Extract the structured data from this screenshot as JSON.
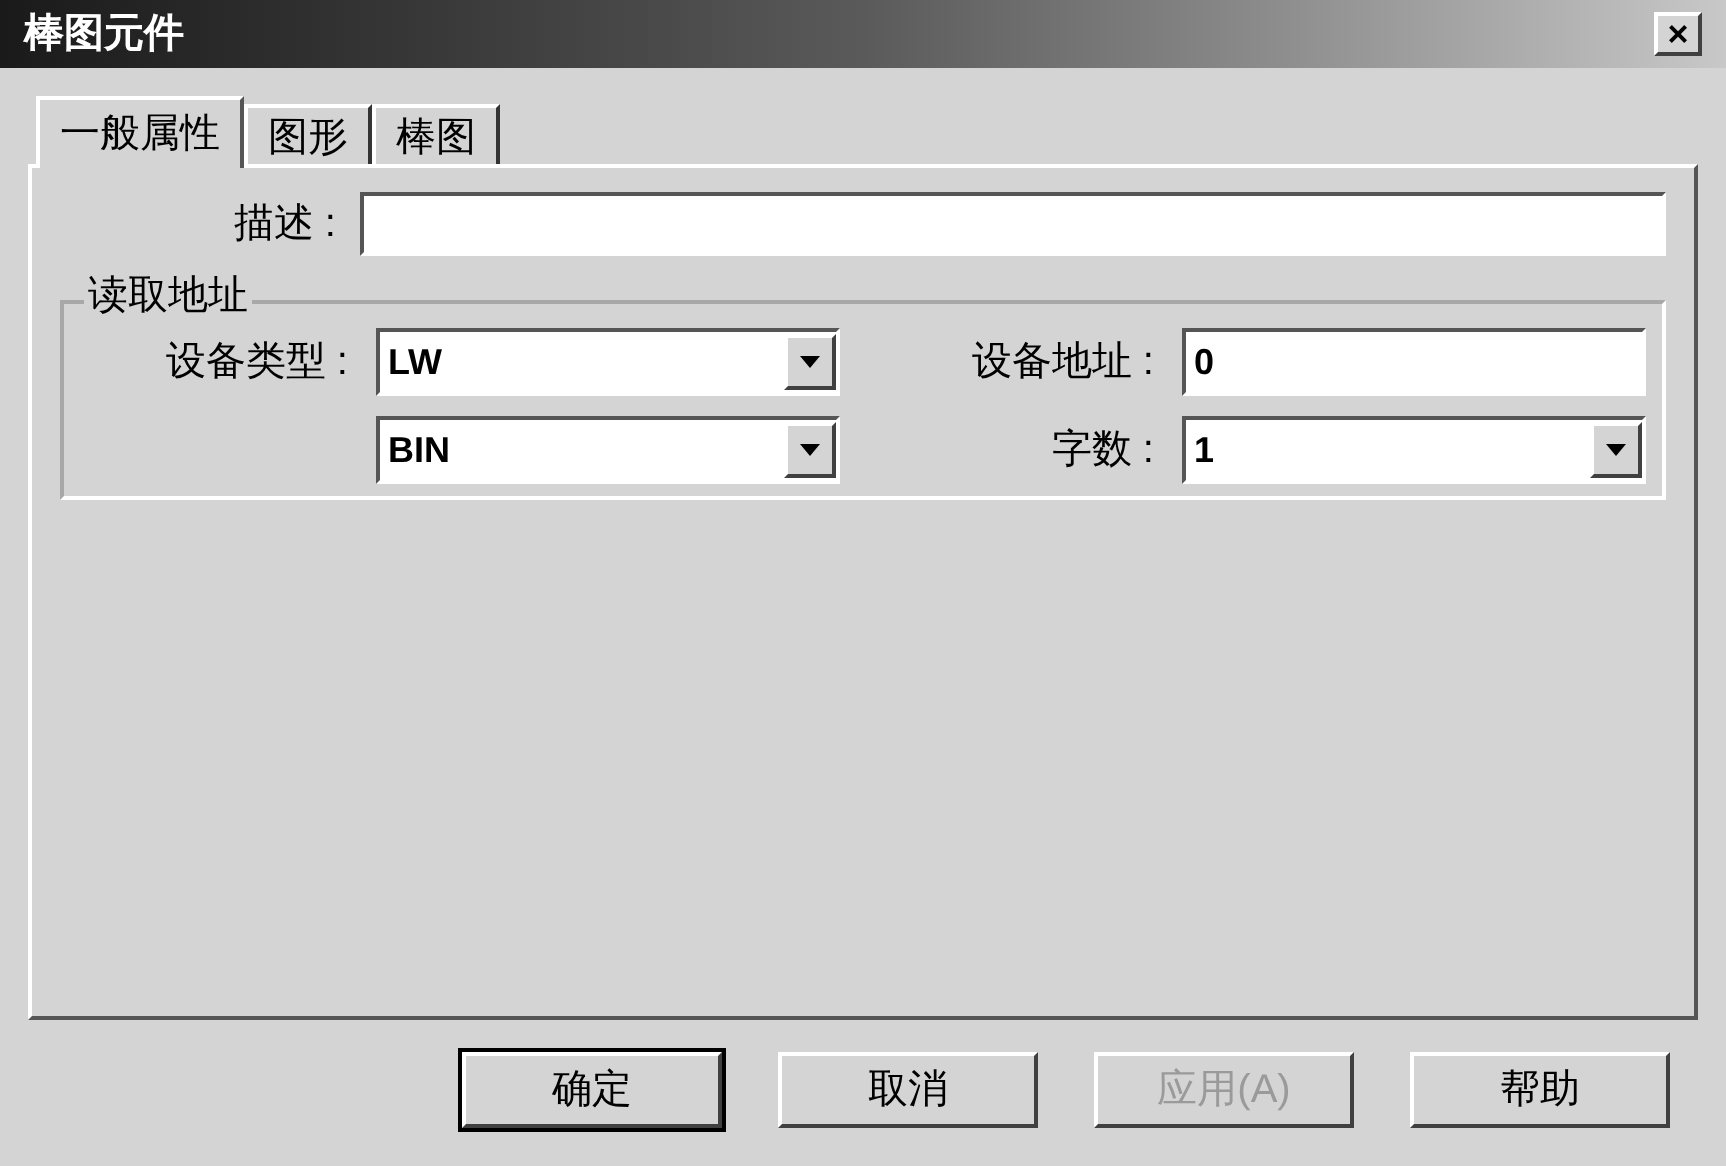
{
  "window": {
    "title": "棒图元件",
    "close": "×"
  },
  "tabs": [
    {
      "label": "一般属性",
      "selected": true
    },
    {
      "label": "图形",
      "selected": false
    },
    {
      "label": "棒图",
      "selected": false
    }
  ],
  "description": {
    "label": "描述 :"
  },
  "group": {
    "title": "读取地址",
    "fields": [
      {
        "label": "设备类型 :",
        "kind": "dropdown",
        "value": "LW"
      },
      {
        "label": "设备地址 :",
        "kind": "text",
        "value": "0"
      },
      {
        "kind": "dropdown",
        "value": "BIN"
      },
      {
        "label": "字数 :",
        "kind": "dropdown",
        "value": "1"
      }
    ]
  },
  "buttons": [
    {
      "label": "确定",
      "default": true,
      "disabled": false
    },
    {
      "label": "取消",
      "default": false,
      "disabled": false
    },
    {
      "label": "应用(A)",
      "default": false,
      "disabled": true
    },
    {
      "label": "帮助",
      "default": false,
      "disabled": false
    }
  ]
}
